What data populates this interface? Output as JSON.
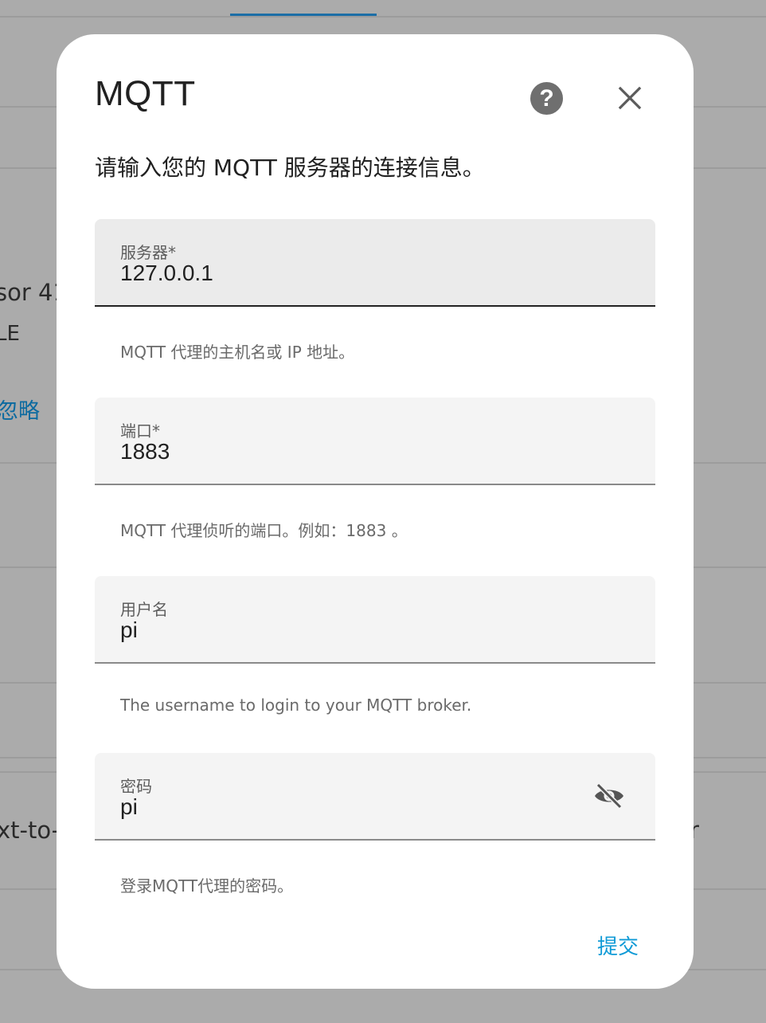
{
  "background": {
    "tab_indicator_color": "#1c6ea6",
    "snippets": {
      "sensor": "sor 41",
      "ble": "LE",
      "ignore": "忽略",
      "text_to": "xt-to-",
      "right_char": "r"
    }
  },
  "dialog": {
    "title": "MQTT",
    "description": "请输入您的 MQTT 服务器的连接信息。",
    "help_icon": "help-circle-icon",
    "help_glyph": "?",
    "close_icon": "close-icon",
    "fields": {
      "broker": {
        "label": "服务器*",
        "value": "127.0.0.1",
        "helper": "MQTT 代理的主机名或 IP 地址。"
      },
      "port": {
        "label": "端口*",
        "value": "1883",
        "helper": "MQTT 代理侦听的端口。例如：1883 。"
      },
      "username": {
        "label": "用户名",
        "value": "pi",
        "helper": "The username to login to your MQTT broker."
      },
      "password": {
        "label": "密码",
        "value": "pi",
        "helper": "登录MQTT代理的密码。",
        "toggle_icon": "eye-off-icon"
      }
    },
    "submit_label": "提交",
    "accent_color": "#0e9ad6"
  }
}
